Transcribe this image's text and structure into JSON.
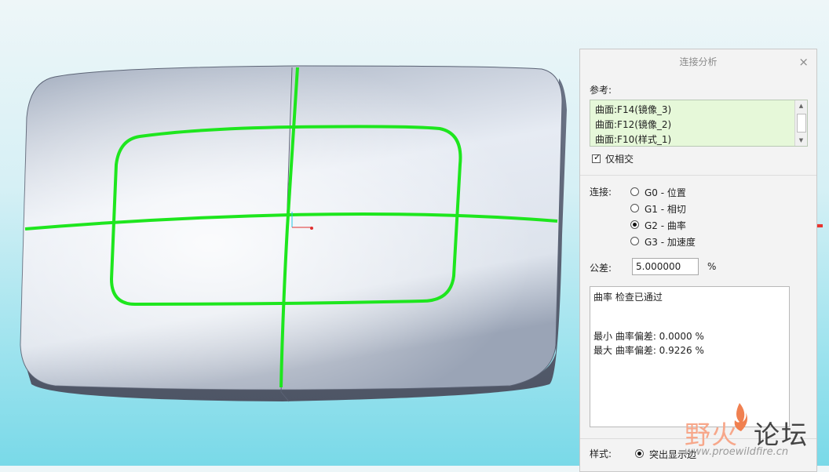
{
  "dialog": {
    "title": "连接分析",
    "close_glyph": "×",
    "references_label": "参考:",
    "references": [
      "曲面:F14(镜像_3)",
      "曲面:F12(镜像_2)",
      "曲面:F10(样式_1)"
    ],
    "intersect_only": {
      "label": "仅相交",
      "checked": true
    },
    "connection_label": "连接:",
    "connection_options": [
      {
        "label": "G0 - 位置",
        "selected": false
      },
      {
        "label": "G1 - 相切",
        "selected": false
      },
      {
        "label": "G2 - 曲率",
        "selected": true
      },
      {
        "label": "G3 - 加速度",
        "selected": false
      }
    ],
    "tolerance_label": "公差:",
    "tolerance_value": "5.000000",
    "tolerance_unit": "%",
    "result": {
      "status": "曲率 检查已通过",
      "min_line": "最小 曲率偏差: 0.0000 %",
      "max_line": "最大 曲率偏差: 0.9226 %"
    },
    "style_label": "样式:",
    "style_option": "突出显示边"
  },
  "watermark": {
    "logo_part1": "野火",
    "logo_part2": "论坛",
    "url": "www.proewildfire.cn"
  },
  "colors": {
    "curve_green": "#1ee61e",
    "arrow_red": "#e8342f",
    "model_light": "#e8edf5",
    "model_dark": "#7a8598",
    "background_cyan": "#79d9e8"
  }
}
